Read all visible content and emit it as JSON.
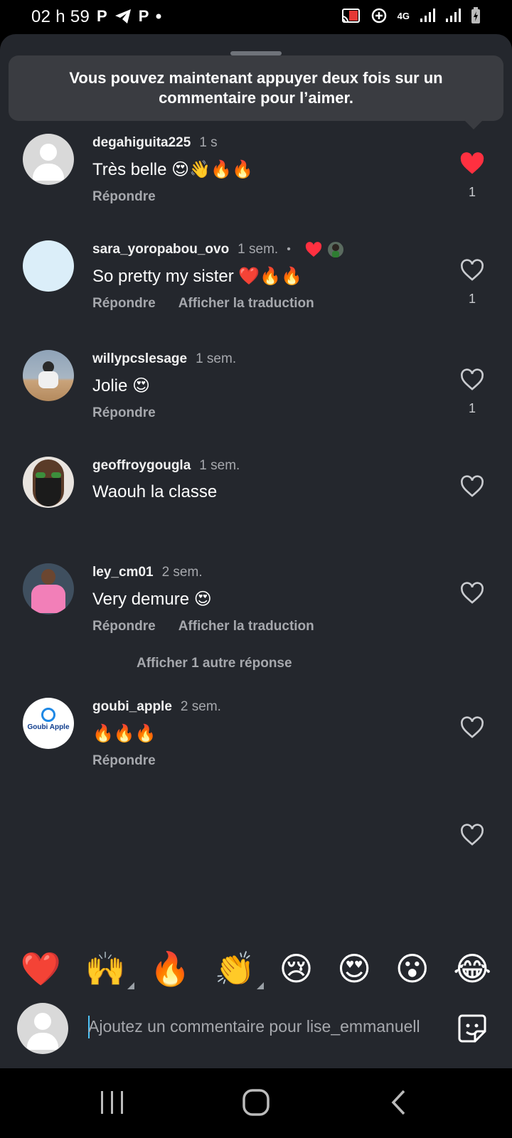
{
  "status_bar": {
    "time": "02 h 59",
    "left_icons": [
      "p-icon",
      "telegram-icon",
      "p-icon",
      "dot-icon"
    ],
    "right_icons": [
      "cast-icon",
      "data-saver-icon",
      "4g-icon",
      "signal-icon",
      "signal-icon",
      "battery-charging-icon"
    ],
    "network_label": "4G"
  },
  "toast": {
    "message": "Vous pouvez maintenant appuyer deux fois sur un commentaire pour l’aimer."
  },
  "comments": [
    {
      "username": "degahiguita225",
      "time": "1 s",
      "text": "Très belle 😍👋🔥🔥",
      "reply": "Répondre",
      "likes": "1",
      "liked": true
    },
    {
      "username": "sara_yoropabou_ovo",
      "time": "1 sem.",
      "text": "So pretty my sister ❤️🔥🔥",
      "reply": "Répondre",
      "translate": "Afficher la traduction",
      "likes": "1",
      "liked": false,
      "author_liked": true
    },
    {
      "username": "willypcslesage",
      "time": "1 sem.",
      "text": "Jolie 😍",
      "reply": "Répondre",
      "likes": "1",
      "liked": false
    },
    {
      "username": "geoffroygougla",
      "time": "1 sem.",
      "text": "Waouh la classe",
      "liked": false
    },
    {
      "username": "ley_cm01",
      "time": "2 sem.",
      "text": "Very demure 😍",
      "reply": "Répondre",
      "translate": "Afficher la traduction",
      "liked": false
    },
    {
      "username": "goubi_apple",
      "time": "2 sem.",
      "text": "🔥🔥🔥",
      "reply": "Répondre",
      "liked": false,
      "avatar_text": "Goubi Apple"
    }
  ],
  "more_replies": "Afficher 1 autre réponse",
  "reactions": [
    "❤️",
    "🙌",
    "🔥",
    "👏",
    "😢",
    "😍",
    "😮",
    "😂"
  ],
  "composer": {
    "placeholder": "Ajoutez un commentaire pour lise_emmanuell"
  },
  "colors": {
    "sheet_bg": "#24272d",
    "liked_red": "#ff3040",
    "secondary_text": "#a6a8ad",
    "toast_bg": "#3a3c41"
  }
}
